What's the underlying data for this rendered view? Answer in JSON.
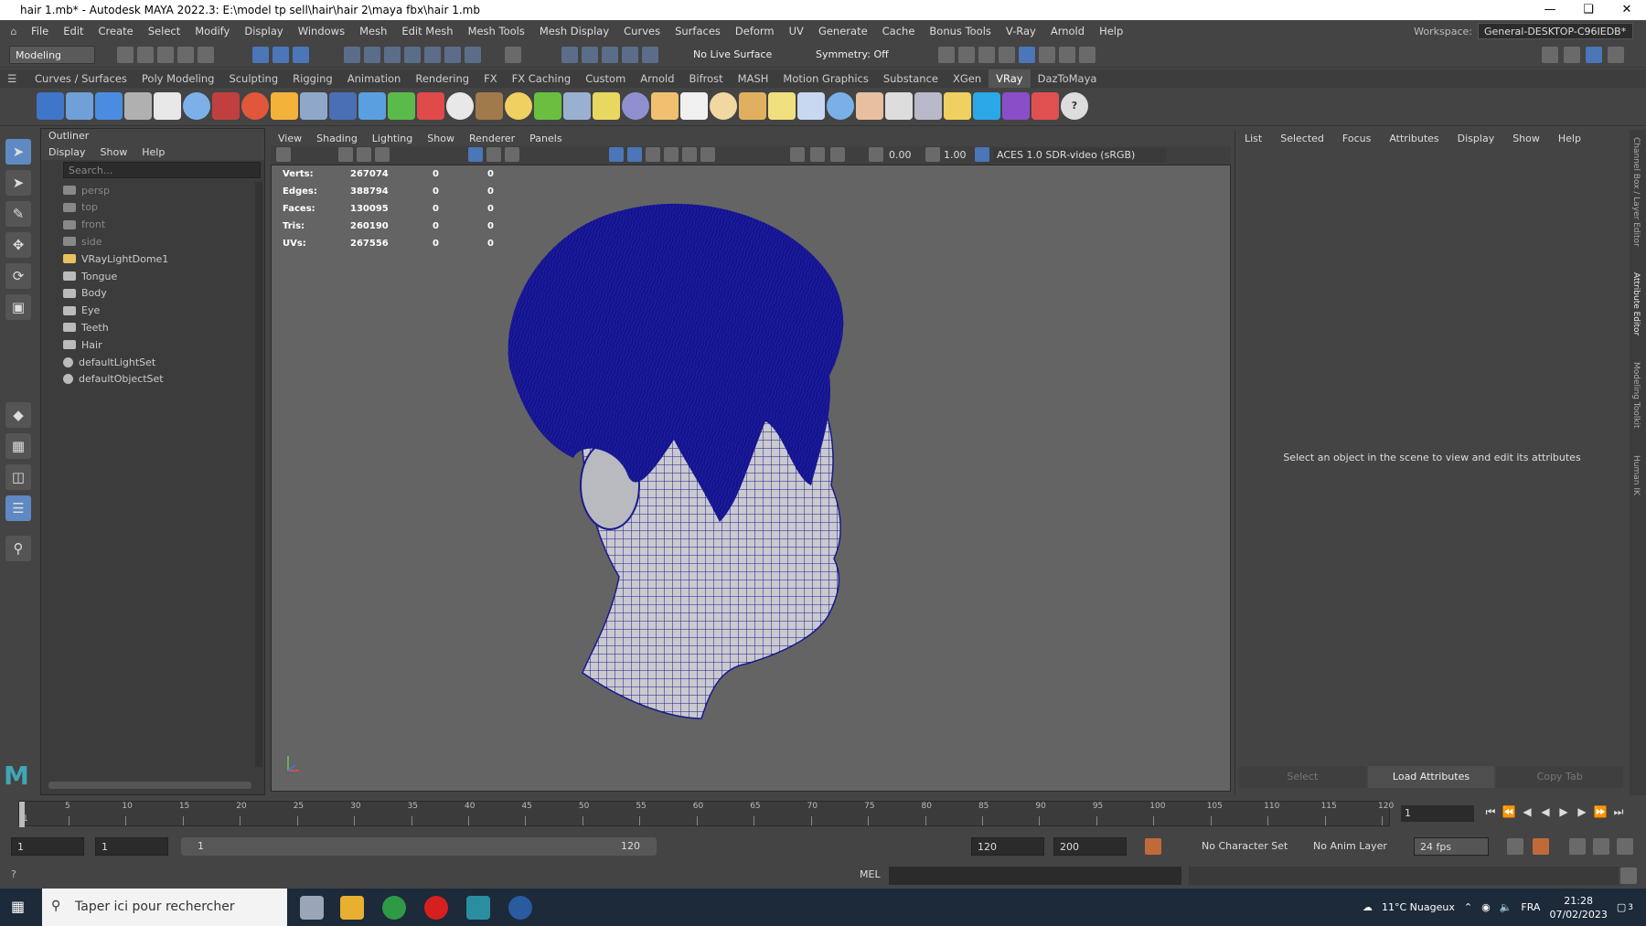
{
  "window": {
    "title": "hair 1.mb* - Autodesk MAYA 2022.3: E:\\model tp sell\\hair\\hair 2\\maya fbx\\hair 1.mb"
  },
  "menu": [
    "File",
    "Edit",
    "Create",
    "Select",
    "Modify",
    "Display",
    "Windows",
    "Mesh",
    "Edit Mesh",
    "Mesh Tools",
    "Mesh Display",
    "Curves",
    "Surfaces",
    "Deform",
    "UV",
    "Generate",
    "Cache",
    "Bonus Tools",
    "V-Ray",
    "Arnold",
    "Help"
  ],
  "workspace": {
    "label": "Workspace:",
    "value": "General-DESKTOP-C96IEDB*"
  },
  "status_line": {
    "mode": "Modeling",
    "live_surface": "No Live Surface",
    "symmetry": "Symmetry: Off"
  },
  "shelf_tabs": [
    "Curves / Surfaces",
    "Poly Modeling",
    "Sculpting",
    "Rigging",
    "Animation",
    "Rendering",
    "FX",
    "FX Caching",
    "Custom",
    "Arnold",
    "Bifrost",
    "MASH",
    "Motion Graphics",
    "Substance",
    "XGen",
    "VRay",
    "DazToMaya"
  ],
  "active_shelf": "VRay",
  "outliner": {
    "title": "Outliner",
    "menu": [
      "Display",
      "Show",
      "Help"
    ],
    "search_placeholder": "Search...",
    "items": [
      {
        "label": "persp",
        "icon": "camera-icon",
        "dim": true
      },
      {
        "label": "top",
        "icon": "camera-icon",
        "dim": true
      },
      {
        "label": "front",
        "icon": "camera-icon",
        "dim": true
      },
      {
        "label": "side",
        "icon": "camera-icon",
        "dim": true
      },
      {
        "label": "VRayLightDome1",
        "icon": "dome-light-icon",
        "dim": false
      },
      {
        "label": "Tongue",
        "icon": "mesh-icon",
        "dim": false
      },
      {
        "label": "Body",
        "icon": "mesh-icon",
        "dim": false
      },
      {
        "label": "Eye",
        "icon": "mesh-icon",
        "dim": false
      },
      {
        "label": "Teeth",
        "icon": "mesh-icon",
        "dim": false
      },
      {
        "label": "Hair",
        "icon": "mesh-icon",
        "dim": false
      },
      {
        "label": "defaultLightSet",
        "icon": "set-icon",
        "dim": false
      },
      {
        "label": "defaultObjectSet",
        "icon": "set-icon",
        "dim": false
      }
    ]
  },
  "viewport": {
    "menu": [
      "View",
      "Shading",
      "Lighting",
      "Show",
      "Renderer",
      "Panels"
    ],
    "exposure": "0.00",
    "gamma": "1.00",
    "color_space": "ACES 1.0 SDR-video (sRGB)",
    "hud": [
      {
        "k": "Verts:",
        "v": "267074",
        "a": "0",
        "b": "0"
      },
      {
        "k": "Edges:",
        "v": "388794",
        "a": "0",
        "b": "0"
      },
      {
        "k": "Faces:",
        "v": "130095",
        "a": "0",
        "b": "0"
      },
      {
        "k": "Tris:",
        "v": "260190",
        "a": "0",
        "b": "0"
      },
      {
        "k": "UVs:",
        "v": "267556",
        "a": "0",
        "b": "0"
      }
    ]
  },
  "attribute_editor": {
    "menu": [
      "List",
      "Selected",
      "Focus",
      "Attributes",
      "Display",
      "Show",
      "Help"
    ],
    "message": "Select an object in the scene to view and edit its attributes",
    "buttons": [
      "Select",
      "Load Attributes",
      "Copy Tab"
    ]
  },
  "side_tabs": [
    "Channel Box / Layer Editor",
    "Attribute Editor",
    "Modeling Toolkit",
    "Human IK"
  ],
  "timeline": {
    "ticks": [
      "5",
      "10",
      "15",
      "20",
      "25",
      "30",
      "35",
      "40",
      "45",
      "50",
      "55",
      "60",
      "65",
      "70",
      "75",
      "80",
      "85",
      "90",
      "95",
      "100",
      "105",
      "110",
      "115",
      "120"
    ],
    "first_tick": "1",
    "current_frame": "1"
  },
  "range": {
    "start": "1",
    "playback_start": "1",
    "slider_start": "1",
    "slider_end": "120",
    "playback_end": "120",
    "end": "200",
    "character_set": "No Character Set",
    "anim_layer": "No Anim Layer",
    "fps": "24 fps"
  },
  "command_line": {
    "label": "MEL"
  },
  "taskbar": {
    "search_placeholder": "Taper ici pour rechercher",
    "weather": "11°C  Nuageux",
    "lang": "FRA",
    "time": "21:28",
    "date": "07/02/2023",
    "notif_count": "3"
  },
  "colors": {
    "accent": "#5e89c2",
    "wire": "#1a1a8c",
    "viewport_bg": "#646464"
  }
}
